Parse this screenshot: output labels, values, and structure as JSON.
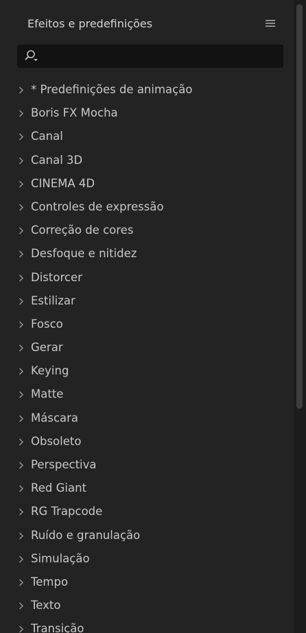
{
  "panel": {
    "title": "Efeitos e predefinições",
    "menu_icon": "hamburger-menu-icon"
  },
  "search": {
    "icon": "search-icon",
    "value": "",
    "placeholder": ""
  },
  "items": [
    {
      "label": "* Predefinições de animação"
    },
    {
      "label": "Boris FX Mocha"
    },
    {
      "label": "Canal"
    },
    {
      "label": "Canal 3D"
    },
    {
      "label": "CINEMA 4D"
    },
    {
      "label": "Controles de expressão"
    },
    {
      "label": "Correção de cores"
    },
    {
      "label": "Desfoque e nitidez"
    },
    {
      "label": "Distorcer"
    },
    {
      "label": "Estilizar"
    },
    {
      "label": "Fosco"
    },
    {
      "label": "Gerar"
    },
    {
      "label": "Keying"
    },
    {
      "label": "Matte"
    },
    {
      "label": "Máscara"
    },
    {
      "label": "Obsoleto"
    },
    {
      "label": "Perspectiva"
    },
    {
      "label": "Red Giant"
    },
    {
      "label": "RG Trapcode"
    },
    {
      "label": "Ruído e granulação"
    },
    {
      "label": "Simulação"
    },
    {
      "label": "Tempo"
    },
    {
      "label": "Texto"
    },
    {
      "label": "Transição"
    }
  ],
  "colors": {
    "panel_bg": "#232323",
    "search_bg": "#121212",
    "text": "#c8c8c8"
  }
}
